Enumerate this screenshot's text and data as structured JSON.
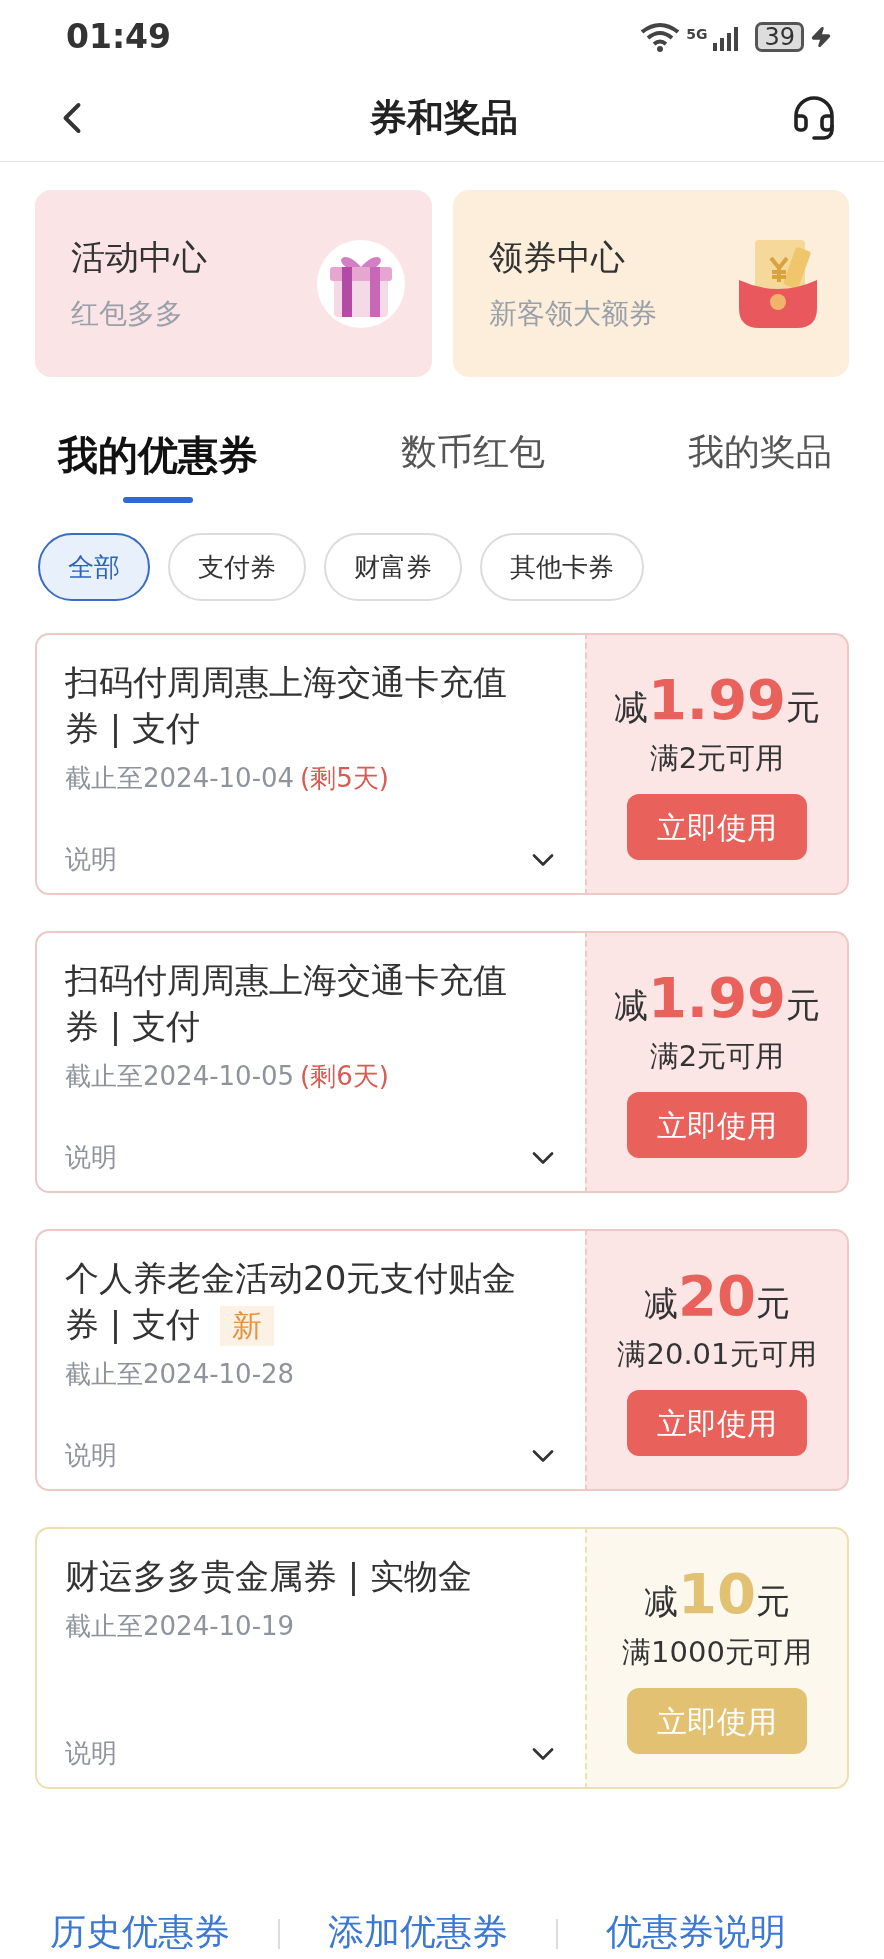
{
  "status_bar": {
    "time": "01:49",
    "network": "5G",
    "battery": "39"
  },
  "header": {
    "title": "券和奖品"
  },
  "promo_cards": [
    {
      "kind": "gift",
      "title": "活动中心",
      "subtitle": "红包多多",
      "color": "#fbe4e6"
    },
    {
      "kind": "envelope",
      "title": "领券中心",
      "subtitle": "新客领大额券",
      "color": "#fdeedb"
    }
  ],
  "tabs": [
    {
      "label": "我的优惠券",
      "selected": true
    },
    {
      "label": "数币红包",
      "selected": false
    },
    {
      "label": "我的奖品",
      "selected": false
    }
  ],
  "filters": [
    {
      "label": "全部",
      "selected": true
    },
    {
      "label": "支付券",
      "selected": false
    },
    {
      "label": "财富券",
      "selected": false
    },
    {
      "label": "其他卡券",
      "selected": false
    }
  ],
  "coupons": [
    {
      "title": "扫码付周周惠上海交通卡充值券 | 支付",
      "deadline": "截止至2024-10-04",
      "remaining": "(剩5天)",
      "note": "说明",
      "prefix": "减",
      "amount": "1.99",
      "unit": "元",
      "condition": "满2元可用",
      "button": "立即使用",
      "color": "#e8615b"
    },
    {
      "title": "扫码付周周惠上海交通卡充值券 | 支付",
      "deadline": "截止至2024-10-05",
      "remaining": "(剩6天)",
      "note": "说明",
      "prefix": "减",
      "amount": "1.99",
      "unit": "元",
      "condition": "满2元可用",
      "button": "立即使用",
      "color": "#e8615b"
    },
    {
      "title": "个人养老金活动20元支付贴金券 | 支付",
      "tag": "新",
      "deadline": "截止至2024-10-28",
      "note": "说明",
      "prefix": "减",
      "amount": "20",
      "unit": "元",
      "condition": "满20.01元可用",
      "button": "立即使用",
      "color": "#e8615b"
    },
    {
      "title": "财运多多贵金属券 | 实物金",
      "deadline": "截止至2024-10-19",
      "note": "说明",
      "prefix": "减",
      "amount": "10",
      "unit": "元",
      "condition": "满1000元可用",
      "button": "立即使用",
      "color": "#e2c272"
    }
  ],
  "footer_links": [
    "历史优惠券",
    "添加优惠券",
    "优惠券说明"
  ]
}
